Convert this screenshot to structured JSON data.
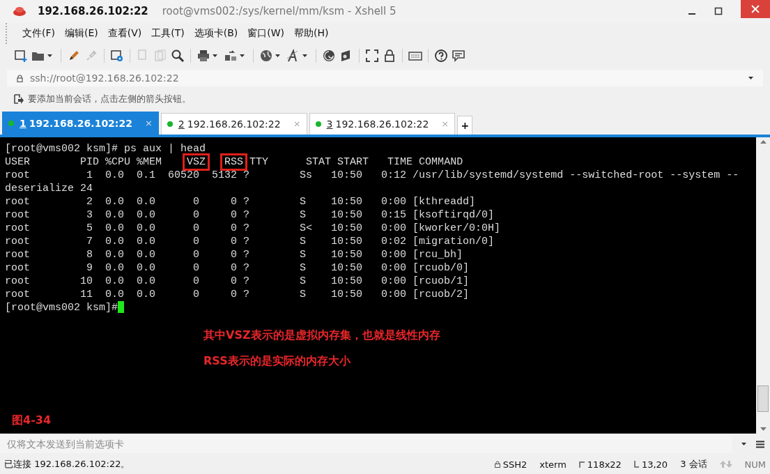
{
  "window": {
    "title": "192.168.26.102:22",
    "subtitle": "root@vms002:/sys/kernel/mm/ksm - Xshell 5"
  },
  "menu": [
    "文件(F)",
    "编辑(E)",
    "查看(V)",
    "工具(T)",
    "选项卡(B)",
    "窗口(W)",
    "帮助(H)"
  ],
  "address_bar": {
    "value": "ssh://root@192.168.26.102:22"
  },
  "hint_bar": {
    "text": "要添加当前会话，点击左侧的箭头按钮。"
  },
  "tabs": [
    {
      "number": "1",
      "label": "192.168.26.102:22",
      "close": "×",
      "selected": true
    },
    {
      "number": "2",
      "label": "192.168.26.102:22",
      "close": "×",
      "selected": false
    },
    {
      "number": "3",
      "label": "192.168.26.102:22",
      "close": "×",
      "selected": false
    }
  ],
  "new_tab": "+",
  "terminal": {
    "lines": [
      {
        "kind": "text",
        "text": "[root@vms002 ksm]# ps aux | head"
      },
      {
        "kind": "header",
        "segments": [
          {
            "text": "USER        PID %CPU %MEM    ",
            "boxed": false
          },
          {
            "text": "VSZ",
            "boxed": true
          },
          {
            "text": "RSS",
            "boxed": true
          },
          {
            "text": " TTY      STAT START   TIME COMMAND",
            "boxed": false
          }
        ]
      },
      {
        "kind": "text",
        "text": "root         1  0.0  0.1  60520  5132 ?        Ss   10:50   0:12 /usr/lib/systemd/systemd --switched-root --system --"
      },
      {
        "kind": "text",
        "text": "deserialize 24"
      },
      {
        "kind": "text",
        "text": "root         2  0.0  0.0      0     0 ?        S    10:50   0:00 [kthreadd]"
      },
      {
        "kind": "text",
        "text": "root         3  0.0  0.0      0     0 ?        S    10:50   0:15 [ksoftirqd/0]"
      },
      {
        "kind": "text",
        "text": "root         5  0.0  0.0      0     0 ?        S<   10:50   0:00 [kworker/0:0H]"
      },
      {
        "kind": "text",
        "text": "root         7  0.0  0.0      0     0 ?        S    10:50   0:02 [migration/0]"
      },
      {
        "kind": "text",
        "text": "root         8  0.0  0.0      0     0 ?        S    10:50   0:00 [rcu_bh]"
      },
      {
        "kind": "text",
        "text": "root         9  0.0  0.0      0     0 ?        S    10:50   0:00 [rcuob/0]"
      },
      {
        "kind": "text",
        "text": "root        10  0.0  0.0      0     0 ?        S    10:50   0:00 [rcuob/1]"
      },
      {
        "kind": "text",
        "text": "root        11  0.0  0.0      0     0 ?        S    10:50   0:00 [rcuob/2]"
      },
      {
        "kind": "prompt",
        "text": "[root@vms002 ksm]#"
      }
    ],
    "notes": [
      "其中VSZ表示的是虚拟内存集，也就是线性内存",
      "RSS表示的是实际的内存大小"
    ],
    "figure_label": "图4-34"
  },
  "send_bar": {
    "placeholder": "仅将文本发送到当前选项卡"
  },
  "status_bar": {
    "connection": "已连接 192.168.26.102:22。",
    "protocol": "SSH2",
    "terminal_type": "xterm",
    "size": "118x22",
    "cursor": "13,20",
    "sessions": "3 会话",
    "num": "NUM"
  }
}
